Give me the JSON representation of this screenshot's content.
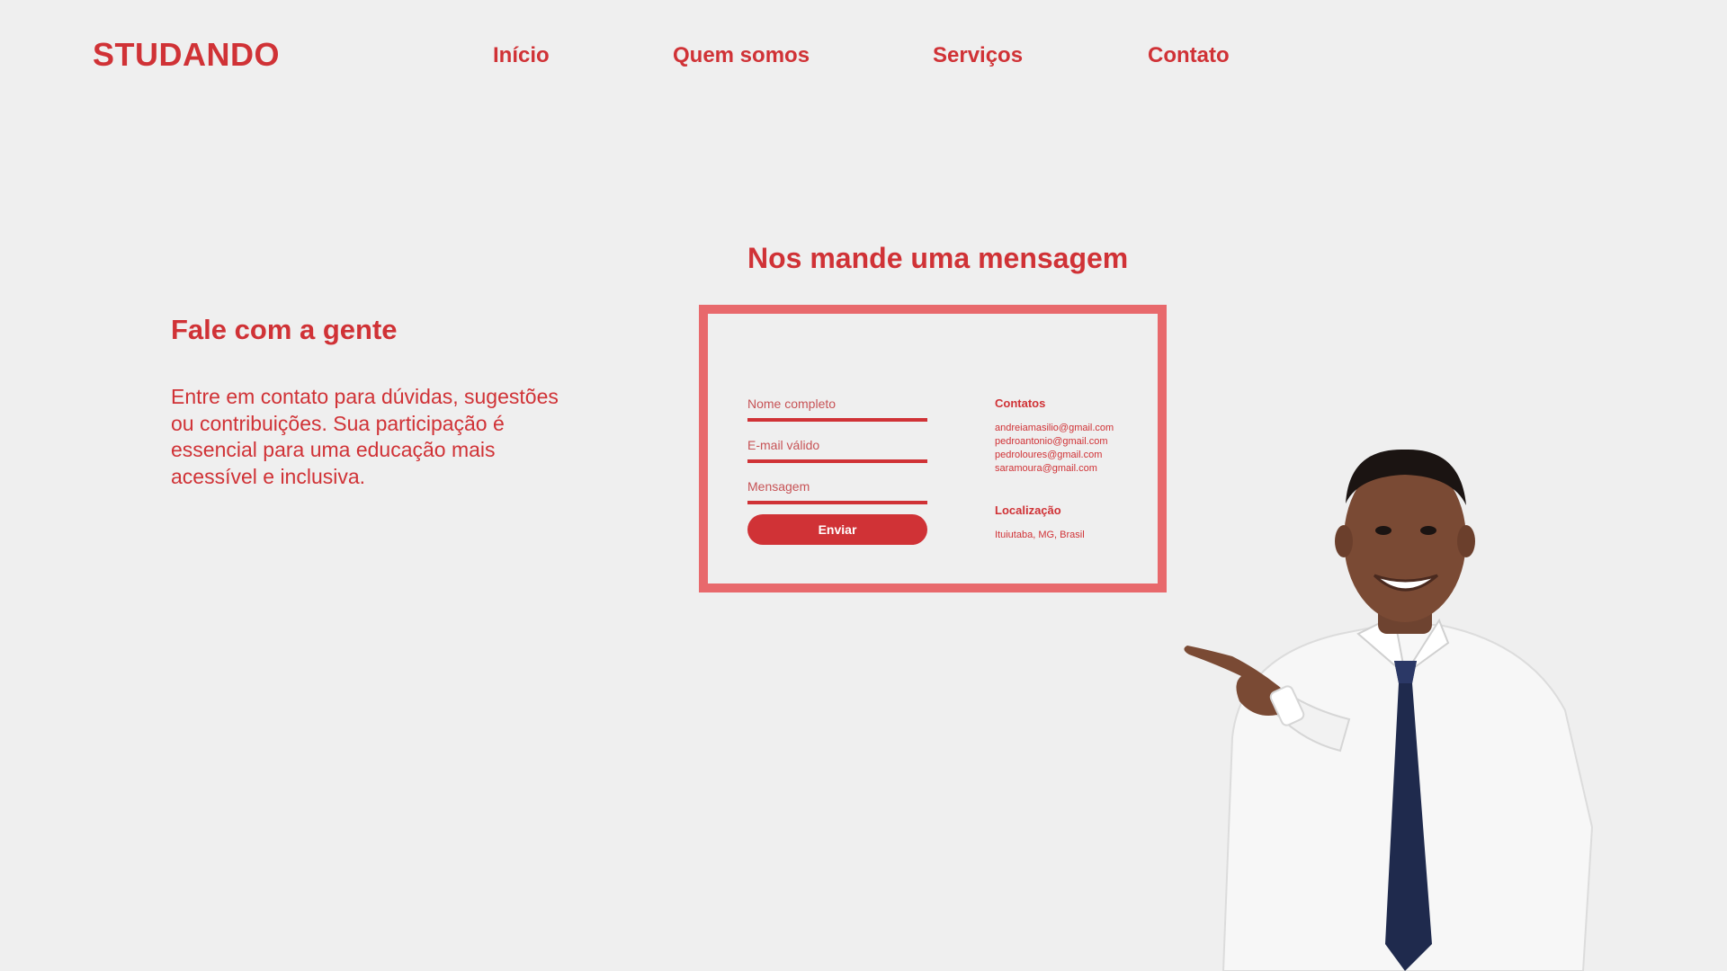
{
  "brand": "STUDANDO",
  "nav": {
    "items": [
      "Início",
      "Quem somos",
      "Serviços",
      "Contato"
    ]
  },
  "intro": {
    "title": "Fale com a gente",
    "text": "Entre em contato para dúvidas, sugestões ou contribuições. Sua participação é essencial para uma educação mais acessível e inclusiva."
  },
  "form": {
    "title": "Nos mande uma mensagem",
    "name_placeholder": "Nome completo",
    "email_placeholder": "E-mail válido",
    "message_placeholder": "Mensagem",
    "submit_label": "Enviar"
  },
  "contacts": {
    "heading": "Contatos",
    "emails": [
      "andreiamasilio@gmail.com",
      "pedroantonio@gmail.com",
      "pedroloures@gmail.com",
      "saramoura@gmail.com"
    ]
  },
  "location": {
    "heading": "Localização",
    "text": "Ituiutaba, MG, Brasil"
  },
  "colors": {
    "primary": "#d03236",
    "border": "#e8696c",
    "background": "#efefef"
  },
  "image": {
    "name": "person-pointing-illustration"
  }
}
